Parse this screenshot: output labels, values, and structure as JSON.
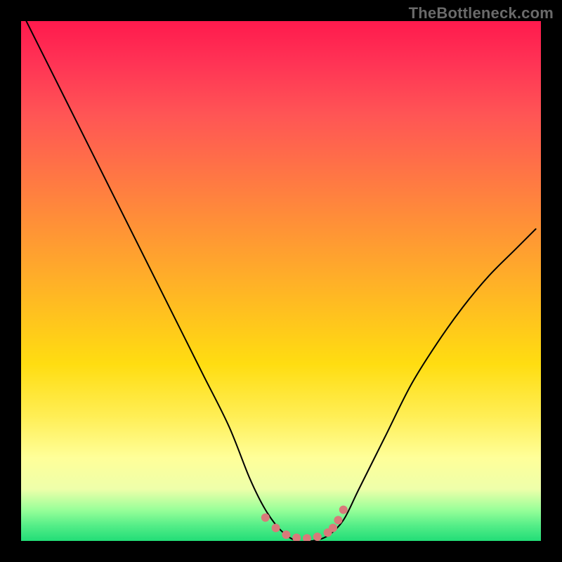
{
  "watermark": "TheBottleneck.com",
  "colors": {
    "frame": "#000000",
    "curve": "#000000",
    "marker": "#d87a7a",
    "gradient_top": "#ff1a4d",
    "gradient_bottom": "#22dd77"
  },
  "chart_data": {
    "type": "line",
    "title": "",
    "xlabel": "",
    "ylabel": "",
    "xlim": [
      0,
      100
    ],
    "ylim": [
      0,
      100
    ],
    "curve": {
      "x": [
        1,
        5,
        10,
        15,
        20,
        25,
        30,
        35,
        40,
        44,
        47,
        50,
        53,
        56,
        59,
        62,
        65,
        70,
        75,
        80,
        85,
        90,
        95,
        99
      ],
      "y": [
        100,
        92,
        82,
        72,
        62,
        52,
        42,
        32,
        22,
        12,
        6,
        2,
        0,
        0,
        1,
        4,
        10,
        20,
        30,
        38,
        45,
        51,
        56,
        60
      ]
    },
    "markers": {
      "x": [
        47,
        49,
        51,
        53,
        55,
        57,
        59,
        60,
        61,
        62
      ],
      "y": [
        4.5,
        2.5,
        1.2,
        0.6,
        0.5,
        0.8,
        1.6,
        2.5,
        4,
        6
      ]
    },
    "annotations": []
  }
}
